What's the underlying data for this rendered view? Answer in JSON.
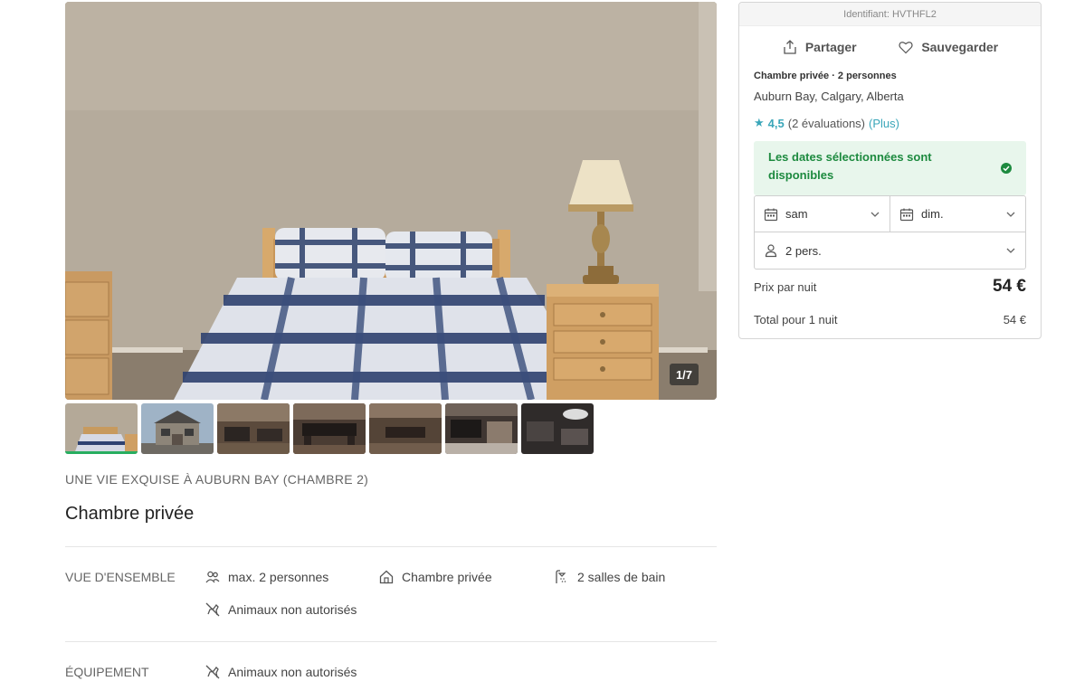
{
  "gallery": {
    "counter": "1/7",
    "thumbnails": [
      "thumb-1",
      "thumb-2",
      "thumb-3",
      "thumb-4",
      "thumb-5",
      "thumb-6",
      "thumb-7"
    ],
    "active_index": 0
  },
  "listing": {
    "title": "UNE VIE EXQUISE À AUBURN BAY (CHAMBRE 2)",
    "room_type": "Chambre privée"
  },
  "overview": {
    "label": "VUE D'ENSEMBLE",
    "features": [
      {
        "icon": "people-icon",
        "text": "max. 2 personnes"
      },
      {
        "icon": "house-icon",
        "text": "Chambre privée"
      },
      {
        "icon": "shower-icon",
        "text": "2 salles de bain"
      },
      {
        "icon": "no-pets-icon",
        "text": "Animaux non autorisés"
      }
    ]
  },
  "equipment": {
    "label": "ÉQUIPEMENT",
    "features": [
      {
        "icon": "no-pets-icon",
        "text": "Animaux non autorisés"
      }
    ]
  },
  "booking": {
    "id_text": "Identifiant: HVTHFL2",
    "share_label": "Partager",
    "save_label": "Sauvegarder",
    "type_line": "Chambre privée · 2 personnes",
    "location": "Auburn Bay, Calgary, Alberta",
    "rating_value": "4,5",
    "rating_count": "(2 évaluations)",
    "rating_more": "(Plus)",
    "availability": "Les dates sélectionnées sont disponibles",
    "checkin": "sam",
    "checkout": "dim.",
    "guests": "2 pers.",
    "price_label": "Prix par nuit",
    "price_value": "54 €",
    "total_label": "Total pour 1 nuit",
    "total_value": "54 €"
  },
  "colors": {
    "accent": "#3aa6b9",
    "available_bg": "#e8f6ec",
    "available_text": "#1d8a3f",
    "active_thumb": "#27ae60"
  }
}
